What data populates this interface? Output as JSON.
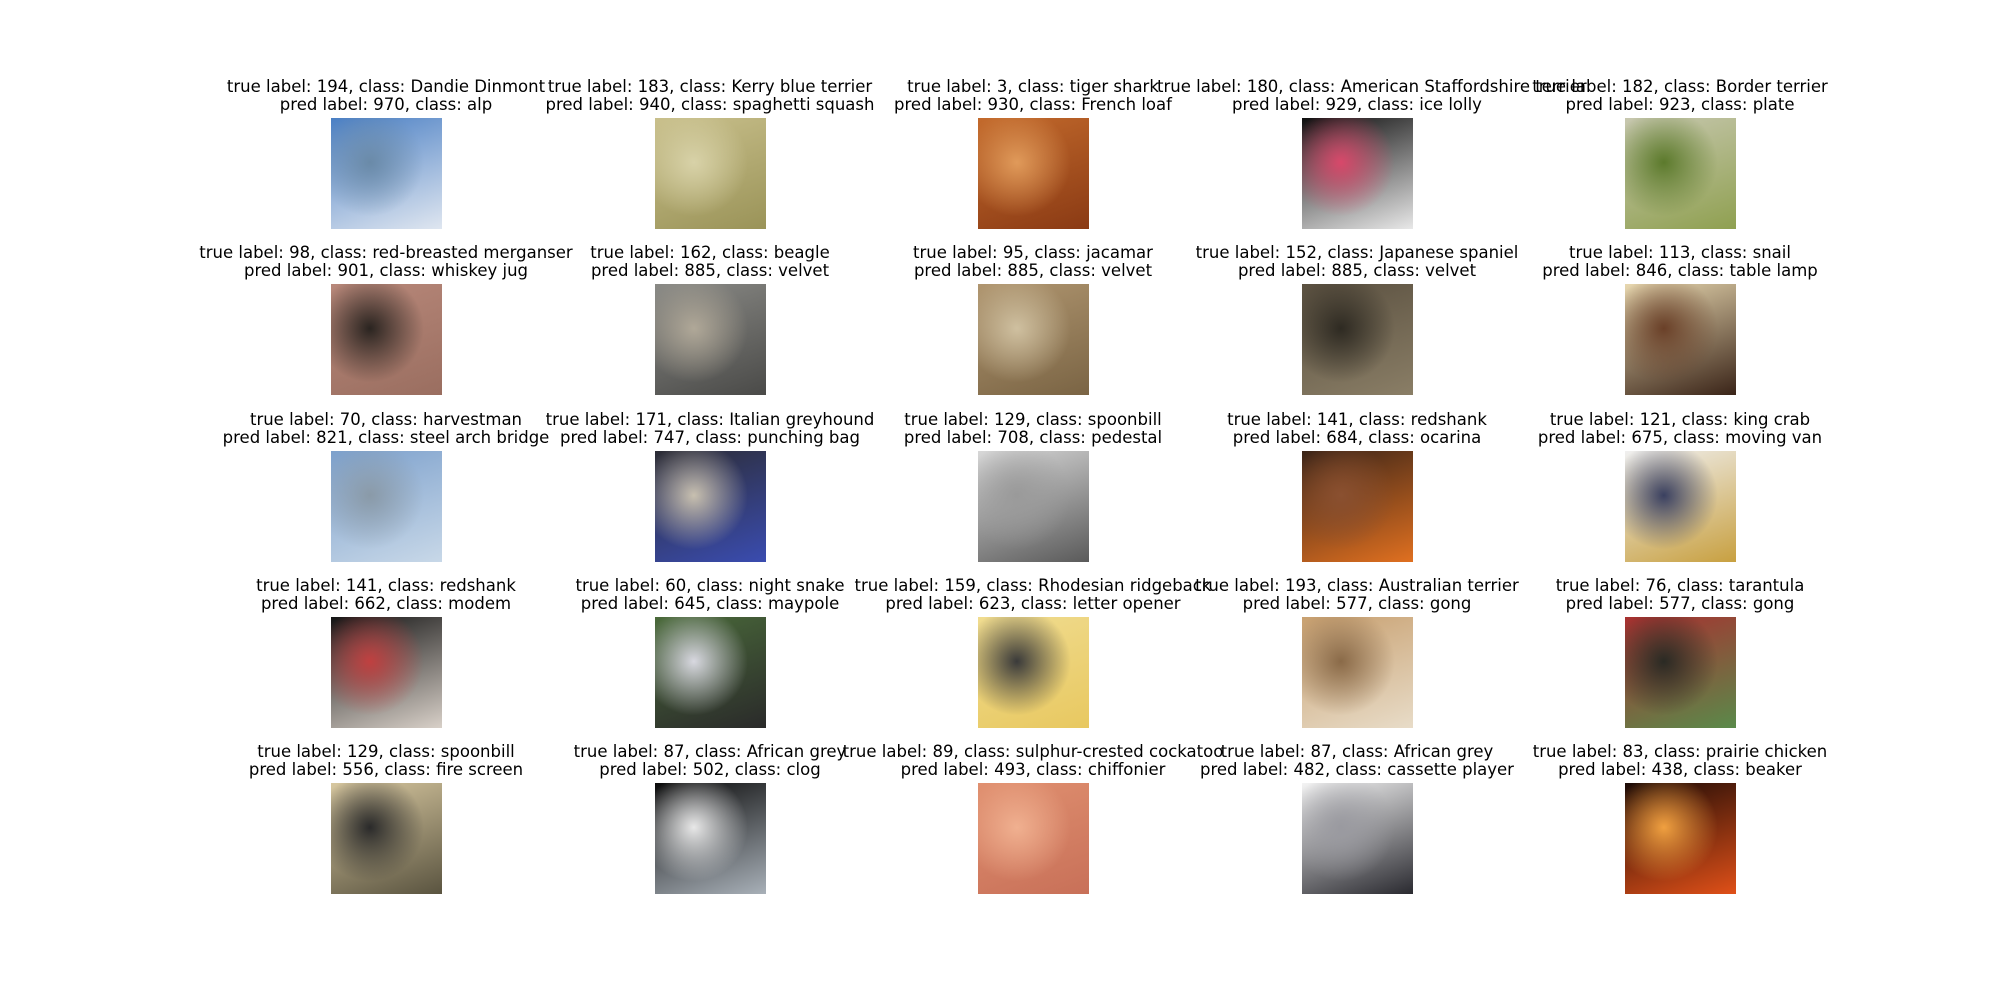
{
  "figure": {
    "panels": [
      {
        "true_text": "true label: 194, class: Dandie Dinmont",
        "pred_text": "pred label: 970, class: alp",
        "thumb_colors": [
          "#4a7fc4",
          "#dfe6f0",
          "#6a8aa8"
        ]
      },
      {
        "true_text": "true label: 183, class: Kerry blue terrier",
        "pred_text": "pred label: 940, class: spaghetti squash",
        "thumb_colors": [
          "#c9c08c",
          "#9a9358",
          "#d8d2a8"
        ]
      },
      {
        "true_text": "true label: 3, class: tiger shark",
        "pred_text": "pred label: 930, class: French loaf",
        "thumb_colors": [
          "#c36a2c",
          "#8a3a14",
          "#e09a5a"
        ]
      },
      {
        "true_text": "true label: 180, class: American Staffordshire terrier",
        "pred_text": "pred label: 929, class: ice lolly",
        "thumb_colors": [
          "#0e0e0e",
          "#e8e8e8",
          "#d8486a"
        ]
      },
      {
        "true_text": "true label: 182, class: Border terrier",
        "pred_text": "pred label: 923, class: plate",
        "thumb_colors": [
          "#c8c8b0",
          "#8fa050",
          "#5c7a2c"
        ]
      },
      {
        "true_text": "true label: 98, class: red-breasted merganser",
        "pred_text": "pred label: 901, class: whiskey jug",
        "thumb_colors": [
          "#b8887a",
          "#9a6e60",
          "#2a2420"
        ]
      },
      {
        "true_text": "true label: 162, class: beagle",
        "pred_text": "pred label: 885, class: velvet",
        "thumb_colors": [
          "#8a8a86",
          "#4a4a48",
          "#b0a898"
        ]
      },
      {
        "true_text": "true label: 95, class: jacamar",
        "pred_text": "pred label: 885, class: velvet",
        "thumb_colors": [
          "#b09670",
          "#7a6444",
          "#cfc0a0"
        ]
      },
      {
        "true_text": "true label: 152, class: Japanese spaniel",
        "pred_text": "pred label: 885, class: velvet",
        "thumb_colors": [
          "#5a5040",
          "#8a7e66",
          "#2e2a22"
        ]
      },
      {
        "true_text": "true label: 113, class: snail",
        "pred_text": "pred label: 846, class: table lamp",
        "thumb_colors": [
          "#e8d8b0",
          "#3a2418",
          "#6a4028"
        ]
      },
      {
        "true_text": "true label: 70, class: harvestman",
        "pred_text": "pred label: 821, class: steel arch bridge",
        "thumb_colors": [
          "#7ca0cc",
          "#c8d8e8",
          "#8a9aa8"
        ]
      },
      {
        "true_text": "true label: 171, class: Italian greyhound",
        "pred_text": "pred label: 747, class: punching bag",
        "thumb_colors": [
          "#2c2c34",
          "#3a4cb0",
          "#c8c0b0"
        ]
      },
      {
        "true_text": "true label: 129, class: spoonbill",
        "pred_text": "pred label: 708, class: pedestal",
        "thumb_colors": [
          "#d8d8d8",
          "#5a5a5a",
          "#9a9a9a"
        ]
      },
      {
        "true_text": "true label: 141, class: redshank",
        "pred_text": "pred label: 684, class: ocarina",
        "thumb_colors": [
          "#3a2418",
          "#e07020",
          "#8a5030"
        ]
      },
      {
        "true_text": "true label: 121, class: king crab",
        "pred_text": "pred label: 675, class: moving van",
        "thumb_colors": [
          "#f0f0f0",
          "#c8a040",
          "#3a4060"
        ]
      },
      {
        "true_text": "true label: 141, class: redshank",
        "pred_text": "pred label: 662, class: modem",
        "thumb_colors": [
          "#141414",
          "#d8d0c8",
          "#c04040"
        ]
      },
      {
        "true_text": "true label: 60, class: night snake",
        "pred_text": "pred label: 645, class: maypole",
        "thumb_colors": [
          "#4a6a3a",
          "#2a2a2a",
          "#d8d8e0"
        ]
      },
      {
        "true_text": "true label: 159, class: Rhodesian ridgeback",
        "pred_text": "pred label: 623, class: letter opener",
        "thumb_colors": [
          "#f0dc90",
          "#e8c860",
          "#3a3a3a"
        ]
      },
      {
        "true_text": "true label: 193, class: Australian terrier",
        "pred_text": "pred label: 577, class: gong",
        "thumb_colors": [
          "#c8a070",
          "#e8dcc8",
          "#8a6a48"
        ]
      },
      {
        "true_text": "true label: 76, class: tarantula",
        "pred_text": "pred label: 577, class: gong",
        "thumb_colors": [
          "#a83030",
          "#5a8a4a",
          "#2a2a24"
        ]
      },
      {
        "true_text": "true label: 129, class: spoonbill",
        "pred_text": "pred label: 556, class: fire screen",
        "thumb_colors": [
          "#d8c8a0",
          "#5a5440",
          "#2a2a2a"
        ]
      },
      {
        "true_text": "true label: 87, class: African grey",
        "pred_text": "pred label: 502, class: clog",
        "thumb_colors": [
          "#0a0a0a",
          "#a8b0b8",
          "#e8e8e8"
        ]
      },
      {
        "true_text": "true label: 89, class: sulphur-crested cockatoo",
        "pred_text": "pred label: 493, class: chiffonier",
        "thumb_colors": [
          "#e09070",
          "#c87058",
          "#f0b090"
        ]
      },
      {
        "true_text": "true label: 87, class: African grey",
        "pred_text": "pred label: 482, class: cassette player",
        "thumb_colors": [
          "#f4f4f4",
          "#2a2a30",
          "#9a9aa0"
        ]
      },
      {
        "true_text": "true label: 83, class: prairie chicken",
        "pred_text": "pred label: 438, class: beaker",
        "thumb_colors": [
          "#1a0a06",
          "#e05018",
          "#f0a040"
        ]
      }
    ]
  }
}
